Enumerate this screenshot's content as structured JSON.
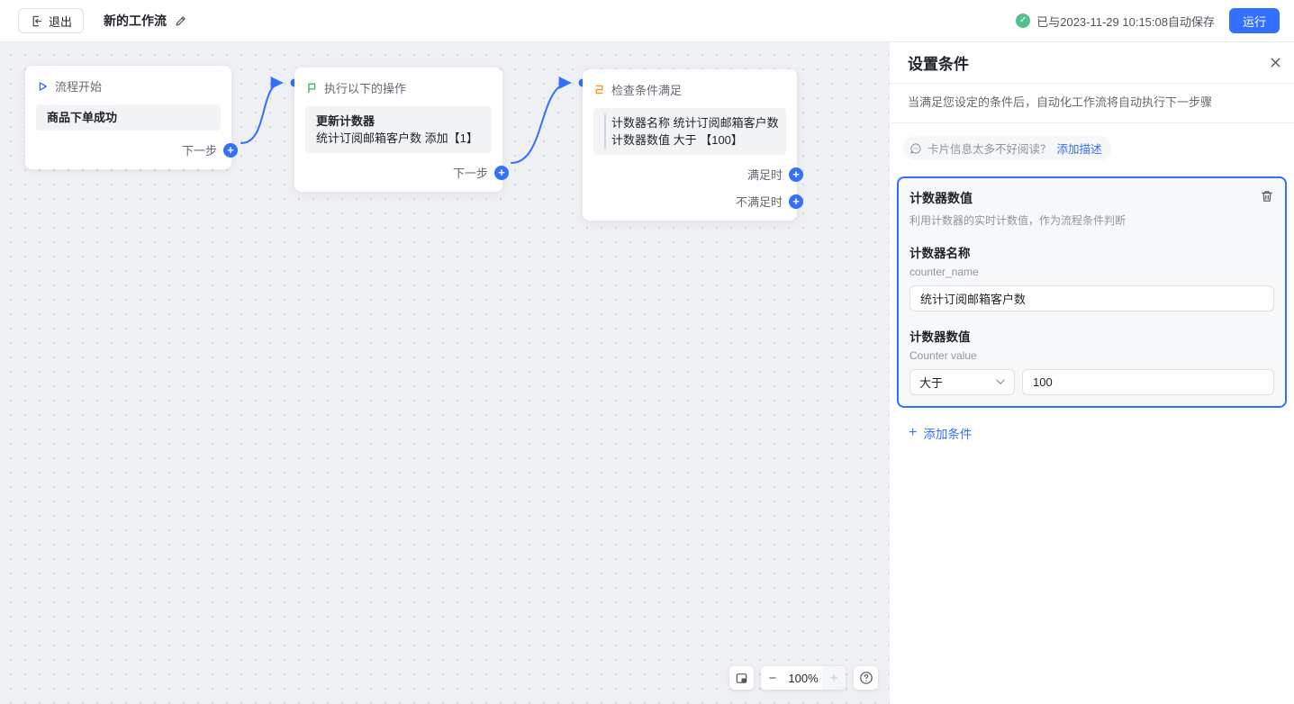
{
  "topbar": {
    "exit": "退出",
    "title": "新的工作流",
    "autosave": "已与2023-11-29 10:15:08自动保存",
    "run": "运行"
  },
  "canvas": {
    "node_start": {
      "header": "流程开始",
      "body": "商品下单成功",
      "next": "下一步"
    },
    "node_action": {
      "header": "执行以下的操作",
      "body_title": "更新计数器",
      "body_text": "统计订阅邮箱客户数 添加【1】",
      "next": "下一步"
    },
    "node_condition": {
      "header": "检查条件满足",
      "line1": "计数器名称 统计订阅邮箱客户数",
      "line2": "计数器数值 大于 【100】",
      "on_true": "满足时",
      "on_false": "不满足时"
    },
    "zoom": {
      "level": "100%"
    }
  },
  "panel": {
    "title": "设置条件",
    "description": "当满足您设定的条件后，自动化工作流将自动执行下一步骤",
    "hint": {
      "question": "卡片信息太多不好阅读？",
      "action": "添加描述"
    },
    "card": {
      "title": "计数器数值",
      "subtitle": "利用计数器的实时计数值，作为流程条件判断",
      "counter_name": {
        "label": "计数器名称",
        "key": "counter_name",
        "value": "统计订阅邮箱客户数"
      },
      "counter_value": {
        "label": "计数器数值",
        "key": "Counter value",
        "operator": "大于",
        "value": "100"
      }
    },
    "add_condition": "添加条件"
  },
  "colors": {
    "accent_blue": "#3370ff",
    "success_green": "#53c08c",
    "flag_green": "#34b368",
    "branch_orange": "#ff9119"
  }
}
